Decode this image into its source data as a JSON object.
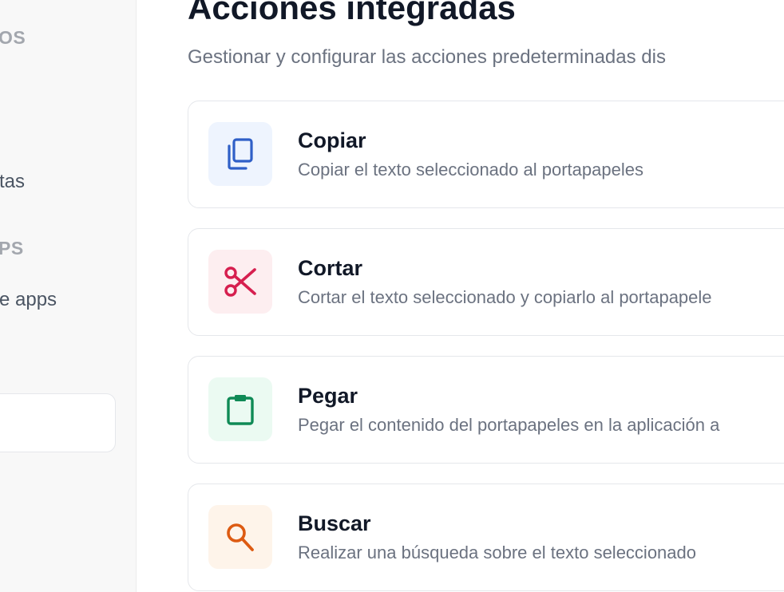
{
  "sidebar": {
    "section_1": "OS",
    "item_1": "tas",
    "section_2": "PS",
    "item_2": "e apps"
  },
  "page": {
    "title": "Acciones integradas",
    "subtitle": "Gestionar y configurar las acciones predeterminadas dis"
  },
  "actions": [
    {
      "title": "Copiar",
      "description": "Copiar el texto seleccionado al portapapeles",
      "icon": "copy-icon",
      "tile_color": "#eef4fe",
      "icon_color": "#2f5fc7"
    },
    {
      "title": "Cortar",
      "description": "Cortar el texto seleccionado y copiarlo al portapapele",
      "icon": "scissors-icon",
      "tile_color": "#fdeef0",
      "icon_color": "#d61f4f"
    },
    {
      "title": "Pegar",
      "description": "Pegar el contenido del portapapeles en la aplicación a",
      "icon": "clipboard-icon",
      "tile_color": "#ebfaf2",
      "icon_color": "#0f8a56"
    },
    {
      "title": "Buscar",
      "description": "Realizar una búsqueda sobre el texto seleccionado",
      "icon": "search-icon",
      "tile_color": "#fef4ea",
      "icon_color": "#dd5b12"
    }
  ]
}
